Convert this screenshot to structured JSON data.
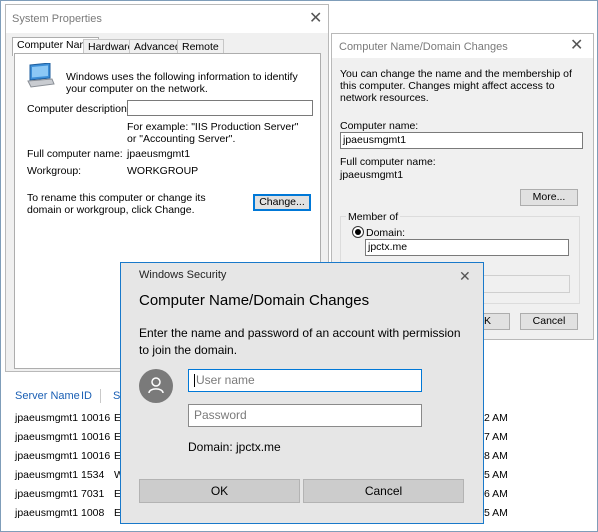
{
  "background_table": {
    "columns": [
      "Server Name",
      "ID",
      "S"
    ],
    "rows": [
      {
        "server": "jpaeusmgmt1",
        "id": "10016",
        "s": "E",
        "time": "2 AM"
      },
      {
        "server": "jpaeusmgmt1",
        "id": "10016",
        "s": "E",
        "time": "7 AM"
      },
      {
        "server": "jpaeusmgmt1",
        "id": "10016",
        "s": "E",
        "time": "8 AM"
      },
      {
        "server": "jpaeusmgmt1",
        "id": "1534",
        "s": "W",
        "time": "5 AM"
      },
      {
        "server": "jpaeusmgmt1",
        "id": "7031",
        "s": "E",
        "time": "6 AM"
      },
      {
        "server": "jpaeusmgmt1",
        "id": "1008",
        "s": "E",
        "time": "5 AM"
      }
    ],
    "stray_char": "s"
  },
  "system_properties": {
    "title": "System Properties",
    "close_glyph": "✕",
    "tabs": [
      "Computer Name",
      "Hardware",
      "Advanced",
      "Remote"
    ],
    "intro": "Windows uses the following information to identify your computer on the network.",
    "description_label": "Computer description:",
    "description_value": "",
    "example_text": "For example: \"IIS Production Server\" or \"Accounting Server\".",
    "full_name_label": "Full computer name:",
    "full_name_value": "jpaeusmgmt1",
    "workgroup_label": "Workgroup:",
    "workgroup_value": "WORKGROUP",
    "rename_text": "To rename this computer or change its domain or workgroup, click Change.",
    "change_button": "Change..."
  },
  "computer_name_dialog": {
    "title": "Computer Name/Domain Changes",
    "close_glyph": "✕",
    "intro": "You can change the name and the membership of this computer. Changes might affect access to network resources.",
    "computer_name_label": "Computer name:",
    "computer_name_value": "jpaeusmgmt1",
    "full_name_label": "Full computer name:",
    "full_name_value": "jpaeusmgmt1",
    "more_button": "More...",
    "member_of_label": "Member of",
    "domain_label": "Domain:",
    "domain_value": "jpctx.me",
    "ok_button_partial": "K",
    "cancel_button": "Cancel"
  },
  "windows_security": {
    "title": "Windows Security",
    "close_glyph": "✕",
    "heading": "Computer Name/Domain Changes",
    "message": "Enter the name and password of an account with permission to join the domain.",
    "username_placeholder": "User name",
    "password_placeholder": "Password",
    "domain_text": "Domain: jpctx.me",
    "ok_button": "OK",
    "cancel_button": "Cancel"
  },
  "colors": {
    "accent": "#0078d7",
    "header_blue": "#1a5fb4",
    "dialog_bg": "#e6e6e6"
  }
}
